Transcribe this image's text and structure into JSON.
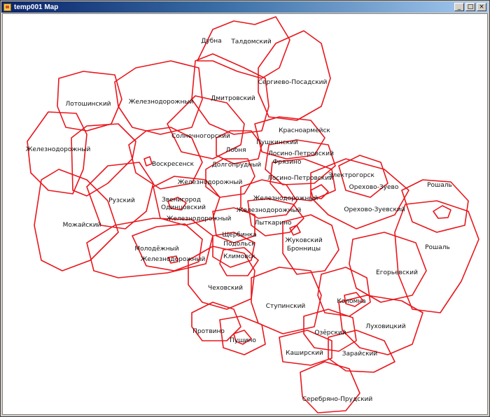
{
  "window": {
    "title": "temp001 Map"
  },
  "controls": {
    "minimize": "_",
    "maximize": "□",
    "close": "×"
  },
  "map": {
    "line_color": "#e8161c",
    "labels": [
      "Дубна",
      "Талдомский",
      "Сергиево-Посадский",
      "Лотошинский",
      "Железнодорожный",
      "Дмитровский",
      "Красноармейск",
      "Железнодорожный",
      "Солнечногорский",
      "Пушкинский",
      "Лобня",
      "Лосино-Петровский",
      "Фрязино",
      "Воскресенск",
      "Долгопрудный",
      "Электрогорск",
      "Лосино-Петровский",
      "Орехово-Зуево",
      "Железнодорожный",
      "Рошаль",
      "Рузский",
      "Звенигород",
      "Одинцовский",
      "Железнодорожный",
      "Орехово-Зуевский",
      "Железнодорожный",
      "Железнодорожный",
      "Можайский",
      "Лыткарино",
      "Щербинка",
      "Подольск",
      "Жуковский",
      "Бронницы",
      "Молодёжный",
      "Климовск",
      "Железнодорожный",
      "Рошаль",
      "Егорьевский",
      "Чеховский",
      "Коломна",
      "Ступинский",
      "Луховицкий",
      "Протвино",
      "Озёрский",
      "Пущино",
      "Каширский",
      "Зарайский",
      "Серебряно-Прудский"
    ]
  }
}
